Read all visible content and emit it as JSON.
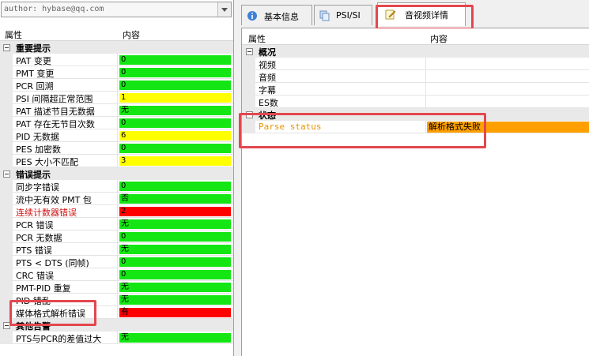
{
  "author_bar": {
    "text": "author: hybase@qq.com"
  },
  "left_table": {
    "col_property": "属性",
    "col_content": "内容",
    "groups": [
      {
        "title": "重要提示",
        "rows": [
          {
            "label": "PAT 变更",
            "value": "0",
            "color": "#14e614"
          },
          {
            "label": "PMT 变更",
            "value": "0",
            "color": "#14e614"
          },
          {
            "label": "PCR 回溯",
            "value": "0",
            "color": "#14e614"
          },
          {
            "label": "PSI 间隔超正常范围",
            "value": "1",
            "color": "#ffff00"
          },
          {
            "label": "PAT 描述节目无数据",
            "value": "无",
            "color": "#14e614"
          },
          {
            "label": "PAT 存在无节目次数",
            "value": "0",
            "color": "#14e614"
          },
          {
            "label": "PID 无数据",
            "value": "6",
            "color": "#ffff00"
          },
          {
            "label": "PES 加密数",
            "value": "0",
            "color": "#14e614"
          },
          {
            "label": "PES 大小不匹配",
            "value": "3",
            "color": "#ffff00"
          }
        ]
      },
      {
        "title": "错误提示",
        "rows": [
          {
            "label": "同步字错误",
            "value": "0",
            "color": "#14e614"
          },
          {
            "label": "流中无有效 PMT 包",
            "value": "否",
            "color": "#14e614"
          },
          {
            "label": "连续计数器错误",
            "value": "2",
            "color": "#ff0000",
            "label_color": "#d01010"
          },
          {
            "label": "PCR 错误",
            "value": "无",
            "color": "#14e614"
          },
          {
            "label": "PCR 无数据",
            "value": "0",
            "color": "#14e614"
          },
          {
            "label": "PTS 错误",
            "value": "无",
            "color": "#14e614"
          },
          {
            "label": "PTS < DTS (同帧)",
            "value": "0",
            "color": "#14e614"
          },
          {
            "label": "CRC 错误",
            "value": "0",
            "color": "#14e614"
          },
          {
            "label": "PMT-PID 重复",
            "value": "无",
            "color": "#14e614"
          },
          {
            "label": "PID 错乱",
            "value": "无",
            "color": "#14e614"
          },
          {
            "label": "媒体格式解析错误",
            "value": "有",
            "color": "#ff0000"
          }
        ]
      },
      {
        "title": "其他告警",
        "rows": [
          {
            "label": "PTS与PCR的差值过大",
            "value": "无",
            "color": "#14e614"
          }
        ]
      }
    ]
  },
  "tabs": [
    {
      "label": "基本信息",
      "icon": "info-icon"
    },
    {
      "label": "PSI/SI",
      "icon": "pages-icon"
    },
    {
      "label": "音视频详情",
      "icon": "edit-note-icon",
      "active": true
    }
  ],
  "right_table": {
    "col_property": "属性",
    "col_content": "内容",
    "groups": [
      {
        "title": "概况",
        "rows": [
          {
            "label": "视频",
            "value": ""
          },
          {
            "label": "音频",
            "value": ""
          },
          {
            "label": "字幕",
            "value": ""
          },
          {
            "label": "ES数",
            "value": ""
          }
        ]
      },
      {
        "title": "状态",
        "rows": [
          {
            "label": "Parse status",
            "value": "解析格式失败",
            "color": "#ffa000",
            "label_color": "#e59400"
          }
        ]
      }
    ]
  }
}
